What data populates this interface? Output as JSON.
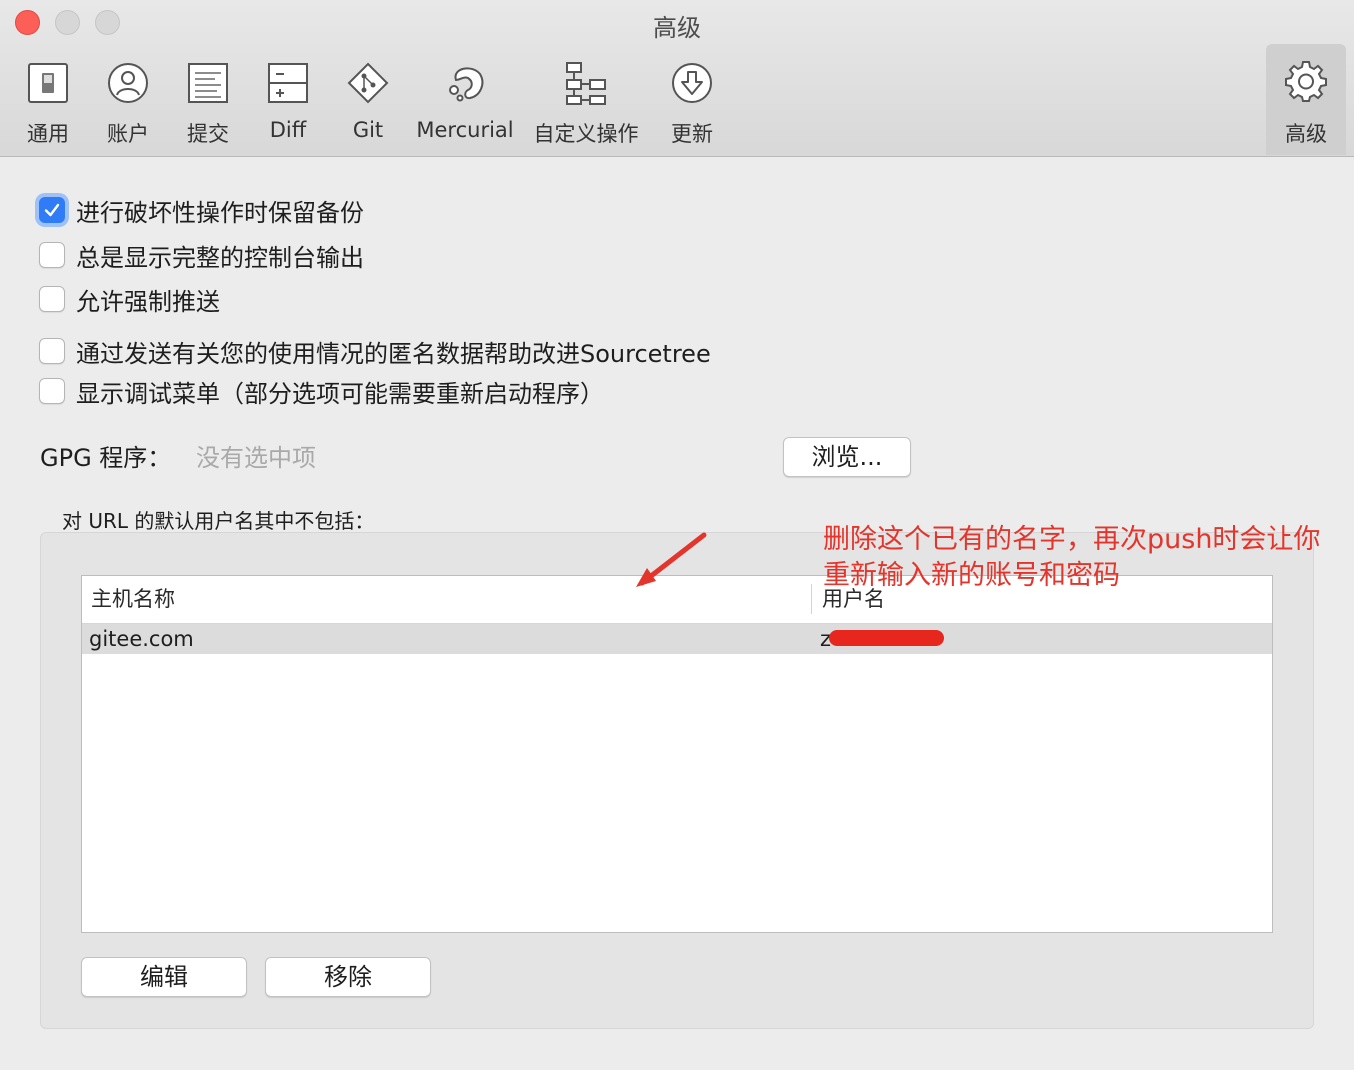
{
  "window": {
    "title": "高级"
  },
  "toolbar": {
    "items": [
      {
        "label": "通用",
        "icon": "switch-icon"
      },
      {
        "label": "账户",
        "icon": "user-icon"
      },
      {
        "label": "提交",
        "icon": "document-icon"
      },
      {
        "label": "Diff",
        "icon": "diff-icon"
      },
      {
        "label": "Git",
        "icon": "git-icon"
      },
      {
        "label": "Mercurial",
        "icon": "mercurial-icon"
      },
      {
        "label": "自定义操作",
        "icon": "custom-actions-icon"
      },
      {
        "label": "更新",
        "icon": "update-icon"
      },
      {
        "label": "高级",
        "icon": "gear-icon",
        "selected": true
      }
    ]
  },
  "options": [
    {
      "label": "进行破坏性操作时保留备份",
      "checked": true
    },
    {
      "label": "总是显示完整的控制台输出",
      "checked": false
    },
    {
      "label": "允许强制推送",
      "checked": false
    },
    {
      "label": "通过发送有关您的使用情况的匿名数据帮助改进Sourcetree",
      "checked": false
    },
    {
      "label": "显示调试菜单（部分选项可能需要重新启动程序）",
      "checked": false
    }
  ],
  "gpg": {
    "label": "GPG 程序：",
    "value": "没有选中项",
    "browse_label": "浏览..."
  },
  "default_users": {
    "group_label": "对 URL 的默认用户名其中不包括：",
    "columns": [
      "主机名称",
      "用户名"
    ],
    "rows": [
      {
        "host": "gitee.com",
        "username": "z"
      }
    ],
    "edit_label": "编辑",
    "remove_label": "移除"
  },
  "annotation": {
    "line1": "删除这个已有的名字，再次push时会让你",
    "line2": "重新输入新的账号和密码",
    "color": "#e3352c"
  }
}
